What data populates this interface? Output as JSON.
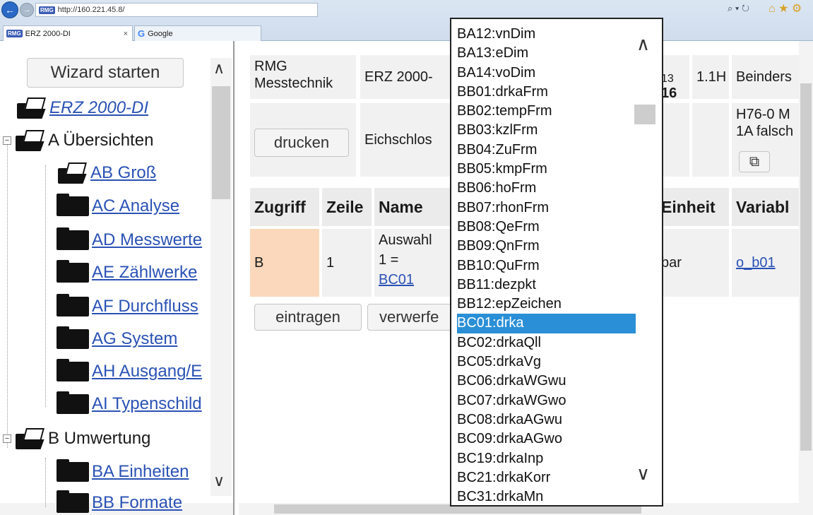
{
  "browser": {
    "url": "http://160.221.45.8/",
    "site_badge": "RMG",
    "tabs": [
      {
        "label": "ERZ 2000-DI",
        "close": "×"
      },
      {
        "label": "Google"
      }
    ],
    "search_glyph": "⌕ ▾ ↻",
    "home_glyphs": "⌂ ★ ⚙"
  },
  "sidebar": {
    "wizard_button": "Wizard starten",
    "root": "ERZ 2000-DI",
    "groups": [
      {
        "label": "A Übersichten",
        "expander": "−"
      },
      {
        "label": "B Umwertung",
        "expander": "−"
      }
    ],
    "items": [
      "AB Groß",
      "AC Analyse",
      "AD Messwerte",
      "AE Zählwerke",
      "AF Durchfluss",
      "AG System",
      "AH Ausgang/E",
      "AI Typenschild",
      "BA Einheiten",
      "BB Formate"
    ],
    "scroll_up": "∧",
    "scroll_down": "∨"
  },
  "header_table": {
    "company": "RMG Messtechnik",
    "device": "ERZ 2000-",
    "version_partial": "13",
    "version_bold": "16",
    "version_suffix": "1.1H",
    "location": "Beinders",
    "print_button": "drucken",
    "eichschloss": "Eichschlos",
    "alarm_line1": "H76-0 M",
    "alarm_line2": "1A falsch",
    "popout_glyph": "⧉"
  },
  "param_table": {
    "headers": [
      "Zugriff",
      "Zeile",
      "Name",
      "Einheit",
      "Variabl"
    ],
    "rows": [
      {
        "zugriff": "B",
        "zeile": "1",
        "name_line1": "Auswahl",
        "name_line2": "1 =",
        "name_link": "BC01",
        "einheit": "bar",
        "variable": "o_b01"
      }
    ],
    "enter_button": "eintragen",
    "discard_button": "verwerfe"
  },
  "dropdown": {
    "options": [
      "BA12:vnDim",
      "BA13:eDim",
      "BA14:voDim",
      "BB01:drkaFrm",
      "BB02:tempFrm",
      "BB03:kzlFrm",
      "BB04:ZuFrm",
      "BB05:kmpFrm",
      "BB06:hoFrm",
      "BB07:rhonFrm",
      "BB08:QeFrm",
      "BB09:QnFrm",
      "BB10:QuFrm",
      "BB11:dezpkt",
      "BB12:epZeichen",
      "BC01:drka",
      "BC02:drkaQll",
      "BC05:drkaVg",
      "BC06:drkaWGwu",
      "BC07:drkaWGwo",
      "BC08:drkaAGwu",
      "BC09:drkaAGwo",
      "BC19:drkaInp",
      "BC21:drkaKorr",
      "BC31:drkaMn"
    ],
    "selected": "BC01:drka",
    "scroll_up": "∧",
    "scroll_down": "∨"
  },
  "colors": {
    "selected_option": "#2a8fd6",
    "zugriff_cell": "#fbd8bb",
    "link": "#2a52b5"
  }
}
